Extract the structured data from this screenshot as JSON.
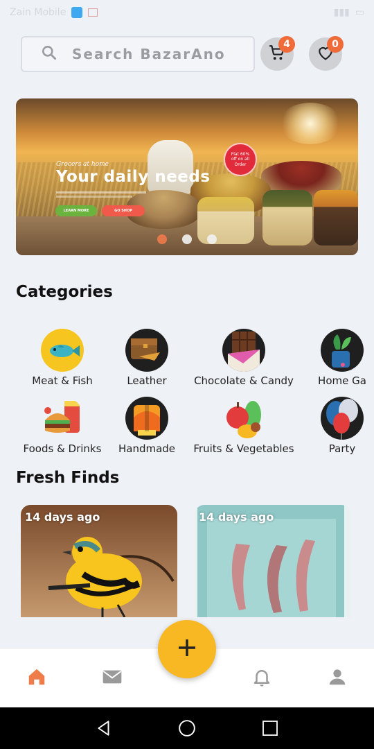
{
  "status_bar": {
    "carrier": "Zain Mobile",
    "time": ""
  },
  "search": {
    "placeholder": "Search BazarAno"
  },
  "header": {
    "cart_count": "4",
    "favorites_count": "0"
  },
  "banner": {
    "tagline": "Grocers at home",
    "headline": "Your daily needs",
    "learn_button": "LEARN MORE",
    "shop_button": "GO SHOP",
    "offer_badge": "Flat 60% off on all Order",
    "slides": 3,
    "active_slide": 1
  },
  "categories": {
    "title": "Categories",
    "row1": [
      {
        "label": "Meat & Fish",
        "icon": "fish-icon"
      },
      {
        "label": "Leather",
        "icon": "leather-bag-icon"
      },
      {
        "label": "Chocolate & Candy",
        "icon": "chocolate-icon"
      },
      {
        "label": "Home Ga",
        "icon": "plant-icon"
      }
    ],
    "row2": [
      {
        "label": "Foods & Drinks",
        "icon": "burger-icon"
      },
      {
        "label": "Handmade",
        "icon": "handmade-icon"
      },
      {
        "label": "Fruits & Vegetables",
        "icon": "fruits-icon"
      },
      {
        "label": "Party",
        "icon": "balloon-icon"
      }
    ]
  },
  "fresh_finds": {
    "title": "Fresh Finds",
    "items": [
      {
        "time": "14 days ago",
        "image": "yellow-bird-image"
      },
      {
        "time": "14 days ago",
        "image": "fish-in-box-image"
      }
    ]
  },
  "bottom_nav": {
    "items": [
      "home-icon",
      "mail-icon",
      "bell-icon",
      "profile-icon"
    ],
    "active": "home",
    "accent_color": "#ef7d4b",
    "fab_color": "#f7b824"
  }
}
